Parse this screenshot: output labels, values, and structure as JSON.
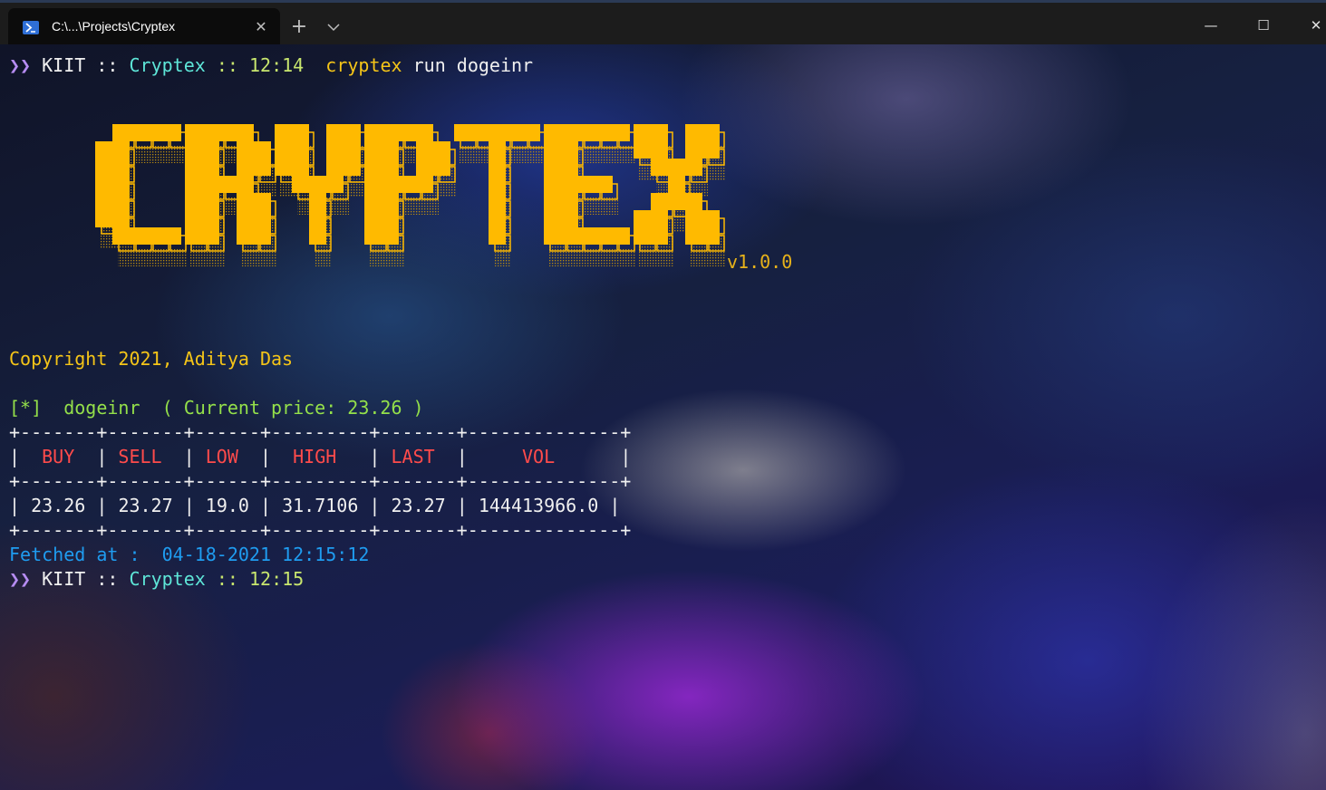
{
  "window": {
    "tab_title": "C:\\...\\Projects\\Cryptex",
    "tab_close": "✕",
    "new_tab": "+",
    "minimize": "—",
    "maximize": "☐",
    "close": "✕"
  },
  "prompt1": {
    "arrow": "❯❯",
    "host": "KIIT",
    "sep1": "::",
    "dir": "Cryptex",
    "sep2": "::",
    "time": "12:14",
    "cmd": "cryptex",
    "args": "run dogeinr"
  },
  "banner": {
    "logo_text": "CRYPTEX",
    "version": "v1.0.0"
  },
  "copyright": "Copyright 2021, Aditya Das",
  "status": {
    "marker": "[*]",
    "pair": "dogeinr",
    "price_text": "( Current price: 23.26 )"
  },
  "table": {
    "border": "+-------+-------+------+---------+-------+--------------+",
    "headers": [
      "BUY",
      "SELL",
      "LOW",
      "HIGH",
      "LAST",
      "VOL"
    ],
    "row": [
      "23.26",
      "23.27",
      "19.0",
      "31.7106",
      "23.27",
      "144413966.0"
    ]
  },
  "fetched": {
    "label": "Fetched at :",
    "value": "04-18-2021 12:15:12"
  },
  "prompt2": {
    "arrow": "❯❯",
    "host": "KIIT",
    "sep1": "::",
    "dir": "Cryptex",
    "sep2": "::",
    "time": "12:15"
  },
  "colors": {
    "logo": "#ffba00",
    "header_text": "#ff4b4b",
    "fetched": "#1f9cf0"
  }
}
